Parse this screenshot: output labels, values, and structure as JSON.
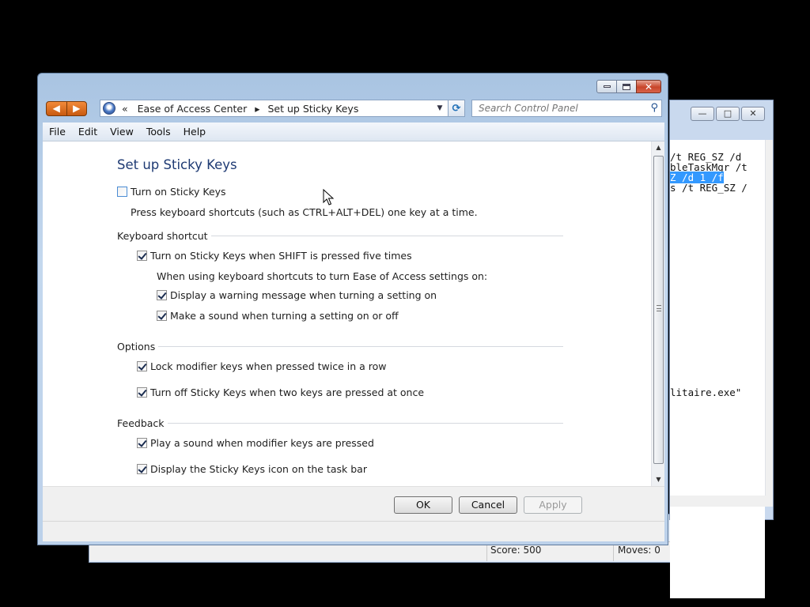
{
  "background": {
    "game_status": {
      "score": "Score: 500",
      "moves": "Moves:  0"
    },
    "cmd_lines": [
      "/t REG_SZ /d",
      "bleTaskMgr /t",
      "Z /d 1 /f",
      "s /t REG_SZ /"
    ],
    "cmd_tail": "litaire.exe\"",
    "cmd_buttons": {
      "min": "—",
      "max": "□",
      "close": "✕"
    }
  },
  "window": {
    "address": {
      "root": "«",
      "crumb1": "Ease of Access Center",
      "sep": "▸",
      "crumb2": "Set up Sticky Keys"
    },
    "search": {
      "placeholder": "Search Control Panel"
    },
    "menu": [
      "File",
      "Edit",
      "View",
      "Tools",
      "Help"
    ],
    "nav": {
      "back": "◀",
      "forward": "▶"
    }
  },
  "content": {
    "title": "Set up Sticky Keys",
    "turn_on": {
      "label": "Turn on Sticky Keys",
      "checked": false
    },
    "turn_on_desc": "Press keyboard shortcuts (such as CTRL+ALT+DEL) one key at a time.",
    "keyboard_shortcut": {
      "heading": "Keyboard shortcut",
      "shift_five": {
        "label": "Turn on Sticky Keys when SHIFT is pressed five times",
        "checked": true
      },
      "sub_desc": "When using keyboard shortcuts to turn Ease of Access settings on:",
      "warning": {
        "label": "Display a warning message when turning a setting on",
        "checked": true
      },
      "sound": {
        "label": "Make a sound when turning a setting on or off",
        "checked": true
      }
    },
    "options": {
      "heading": "Options",
      "lock": {
        "label": "Lock modifier keys when pressed twice in a row",
        "checked": true
      },
      "turn_off": {
        "label": "Turn off Sticky Keys when two keys are pressed at once",
        "checked": true
      }
    },
    "feedback": {
      "heading": "Feedback",
      "play_sound": {
        "label": "Play a sound when modifier keys are pressed",
        "checked": true
      },
      "taskbar_icon": {
        "label": "Display the Sticky Keys icon on the task bar",
        "checked": true
      }
    }
  },
  "buttons": {
    "ok": "OK",
    "cancel": "Cancel",
    "apply": "Apply"
  }
}
